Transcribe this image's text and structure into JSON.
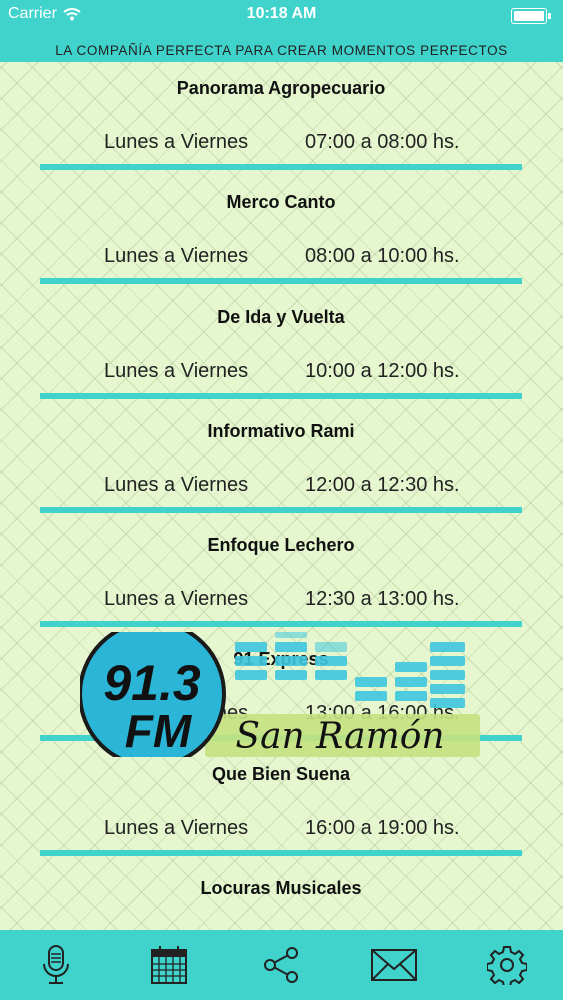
{
  "status_bar": {
    "carrier": "Carrier",
    "time": "10:18 AM"
  },
  "header": {
    "tagline": "LA COMPAÑÍA PERFECTA PARA CREAR MOMENTOS PERFECTOS"
  },
  "programs": [
    {
      "title": "Panorama Agropecuario",
      "days": "Lunes a Viernes",
      "time": "07:00 a 08:00 hs."
    },
    {
      "title": "Merco Canto",
      "days": "Lunes a Viernes",
      "time": "08:00 a 10:00 hs."
    },
    {
      "title": "De Ida y Vuelta",
      "days": "Lunes a Viernes",
      "time": "10:00 a 12:00 hs."
    },
    {
      "title": "Informativo Rami",
      "days": "Lunes a Viernes",
      "time": "12:00 a 12:30 hs."
    },
    {
      "title": "Enfoque Lechero",
      "days": "Lunes a Viernes",
      "time": "12:30 a 13:00 hs."
    },
    {
      "title": "91 Express",
      "days": "Lunes a Viernes",
      "time": "13:00 a 16:00 hs."
    },
    {
      "title": "Que Bien Suena",
      "days": "Lunes a Viernes",
      "time": "16:00 a 19:00 hs."
    },
    {
      "title": "Locuras Musicales",
      "days": "",
      "time": ""
    }
  ],
  "logo": {
    "frequency": "91.3",
    "band": "FM",
    "name": "San Ramón"
  },
  "tabbar": {
    "items": [
      {
        "icon": "microphone-icon"
      },
      {
        "icon": "calendar-icon"
      },
      {
        "icon": "share-icon"
      },
      {
        "icon": "mail-icon"
      },
      {
        "icon": "gear-icon"
      }
    ]
  },
  "colors": {
    "accent": "#3fd3cb",
    "background": "#e6f6cf",
    "logo_blue": "#2bb5d6",
    "logo_green": "#c5e27f"
  }
}
